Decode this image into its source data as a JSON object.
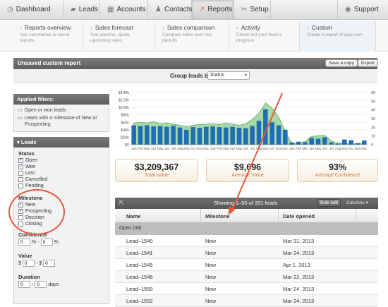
{
  "nav": {
    "tabs": [
      {
        "label": "Dashboard",
        "icon": "dashboard-icon",
        "glyph": "◷"
      },
      {
        "label": "Leads",
        "icon": "leads-icon",
        "glyph": "▰"
      },
      {
        "label": "Accounts",
        "icon": "accounts-icon",
        "glyph": "▦"
      },
      {
        "label": "Contacts",
        "icon": "contacts-icon",
        "glyph": "♟"
      },
      {
        "label": "Reports",
        "icon": "reports-icon",
        "glyph": "↗"
      },
      {
        "label": "Setup",
        "icon": "setup-icon",
        "glyph": "✂"
      }
    ],
    "support": {
      "label": "Support",
      "glyph": "◉"
    }
  },
  "subnav": [
    {
      "title": "Reports overview",
      "desc": "See summaries & saved reports."
    },
    {
      "title": "Sales forecast",
      "desc": "See pipeline, quota, upcoming sales"
    },
    {
      "title": "Sales comparison",
      "desc": "Compare sales over two periods"
    },
    {
      "title": "Activity",
      "desc": "Check out your team's progress"
    },
    {
      "title": "Custom",
      "desc": "Create a report of your own"
    }
  ],
  "report": {
    "title": "Unsaved custom report",
    "save_label": "Save a copy",
    "export_label": "Export",
    "group_label": "Group leads by",
    "group_value": "Status"
  },
  "filters": {
    "title": "Applied filters:",
    "items": [
      "Open or won leads",
      "Leads with a milestone of New or Prospecting"
    ]
  },
  "leads_panel": {
    "title": "Leads",
    "status_title": "Status",
    "status": [
      {
        "label": "Open",
        "checked": true
      },
      {
        "label": "Won",
        "checked": true
      },
      {
        "label": "Lost",
        "checked": false
      },
      {
        "label": "Cancelled",
        "checked": false
      },
      {
        "label": "Pending",
        "checked": false
      }
    ],
    "milestone_title": "Milestone",
    "milestone": [
      {
        "label": "New",
        "checked": true
      },
      {
        "label": "Prospecting",
        "checked": true
      },
      {
        "label": "Decision",
        "checked": false
      },
      {
        "label": "Closing",
        "checked": false
      }
    ],
    "confidence_title": "Confidence",
    "confidence_from": "0",
    "confidence_to": "0",
    "confidence_unit": "%",
    "value_title": "Value",
    "value_from": "0",
    "value_to": "0",
    "value_unit": "$",
    "duration_title": "Duration",
    "duration_from": "0",
    "duration_to": "0",
    "duration_unit": "days"
  },
  "chart_data": {
    "type": "bar",
    "categories": [
      "Jan",
      "Feb",
      "Mar",
      "Apr",
      "May",
      "Jun",
      "Jul",
      "Aug",
      "Sep",
      "Oct",
      "Nov",
      "Dec",
      "Jan",
      "Feb",
      "Mar",
      "Apr",
      "May",
      "Jun",
      "Jul",
      "Aug",
      "Sep",
      "Oct",
      "Nov",
      "Dec",
      "Jan",
      "Feb",
      "Mar",
      "Apr",
      "May",
      "Jun",
      "Jul",
      "Aug",
      "Sep",
      "Oct",
      "Nov",
      "Dec"
    ],
    "values": [
      52,
      50,
      52,
      49,
      50,
      48,
      51,
      46,
      40,
      47,
      45,
      48,
      49,
      47,
      46,
      48,
      45,
      44,
      50,
      64,
      95,
      60,
      52,
      40,
      6,
      8,
      7,
      18,
      16,
      20,
      6,
      3,
      14,
      12,
      4,
      11
    ],
    "area_values": [
      58,
      60,
      58,
      62,
      56,
      58,
      55,
      52,
      48,
      52,
      54,
      55,
      56,
      54,
      58,
      55,
      52,
      56,
      68,
      84,
      112,
      98,
      74,
      36,
      3,
      4,
      8,
      22,
      24,
      25,
      10,
      4,
      3,
      2,
      2,
      3
    ],
    "yticks_left": [
      "$0",
      "$20k",
      "$40k",
      "$60k",
      "$80k",
      "$100k",
      "$120k",
      "$140k"
    ],
    "yticks_right": [
      "0",
      "10",
      "20",
      "30",
      "40",
      "50",
      "60"
    ],
    "ylim": [
      0,
      140
    ],
    "bar_color": "#1f6db5",
    "area_color": "#9fd6a0"
  },
  "stats": [
    {
      "value": "$3,209,367",
      "label": "Total Value"
    },
    {
      "value": "$9,696",
      "label": "Average Value"
    },
    {
      "value": "93%",
      "label": "Average Confidence"
    }
  ],
  "table": {
    "showing": "Showing 1–50 of 331 leads",
    "bulk_label": "Bulk edit",
    "columns_label": "Columns",
    "headers": [
      "Name",
      "Milestone",
      "Date opened"
    ],
    "group": "Open (39)",
    "rows": [
      [
        "Lead–1540",
        "New",
        "Mar 31, 2013"
      ],
      [
        "Lead–1541",
        "New",
        "Mar 24, 2013"
      ],
      [
        "Lead–1545",
        "New",
        "Apr 1, 2013"
      ],
      [
        "Lead–1546",
        "New",
        "Mar 22, 2013"
      ],
      [
        "Lead–1550",
        "New",
        "Mar 24, 2013"
      ],
      [
        "Lead–1552",
        "New",
        "Mar 24, 2013"
      ]
    ]
  },
  "colors": {
    "accent": "#e07a2c",
    "annotation": "#e3573a"
  }
}
